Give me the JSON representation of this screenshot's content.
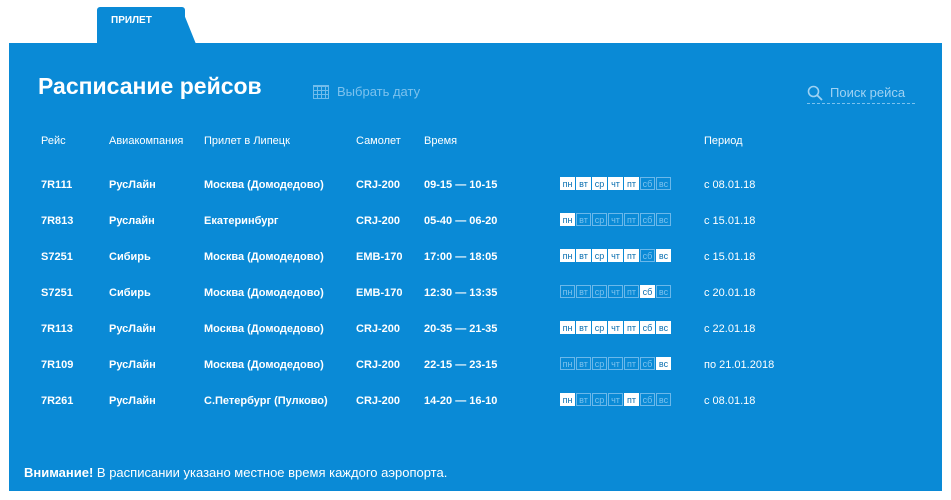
{
  "tab": {
    "label": "ПРИЛЕТ"
  },
  "header": {
    "title": "Расписание рейсов",
    "date_picker_label": "Выбрать дату",
    "search_label": "Поиск рейса"
  },
  "columns": {
    "flight": "Рейс",
    "airline": "Авиакомпания",
    "arrival": "Прилет в Липецк",
    "aircraft": "Самолет",
    "time": "Время",
    "period": "Период"
  },
  "day_labels": [
    "пн",
    "вт",
    "ср",
    "чт",
    "пт",
    "сб",
    "вс"
  ],
  "flights": [
    {
      "flight": "7R111",
      "airline": "РусЛайн",
      "from": "Москва (Домодедово)",
      "aircraft": "CRJ-200",
      "time": "09-15 — 10-15",
      "days": [
        1,
        1,
        1,
        1,
        1,
        0,
        0
      ],
      "period": "с 08.01.18"
    },
    {
      "flight": "7R813",
      "airline": "Руслайн",
      "from": "Екатеринбург",
      "aircraft": "CRJ-200",
      "time": "05-40 — 06-20",
      "days": [
        1,
        0,
        0,
        0,
        0,
        0,
        0
      ],
      "period": "с 15.01.18"
    },
    {
      "flight": "S7251",
      "airline": "Сибирь",
      "from": "Москва (Домодедово)",
      "aircraft": "EMB-170",
      "time": "17:00 — 18:05",
      "days": [
        1,
        1,
        1,
        1,
        1,
        0,
        1
      ],
      "period": "с 15.01.18"
    },
    {
      "flight": "S7251",
      "airline": "Сибирь",
      "from": "Москва (Домодедово)",
      "aircraft": "EMB-170",
      "time": "12:30 — 13:35",
      "days": [
        0,
        0,
        0,
        0,
        0,
        1,
        0
      ],
      "period": "с 20.01.18"
    },
    {
      "flight": "7R113",
      "airline": "РусЛайн",
      "from": "Москва (Домодедово)",
      "aircraft": "CRJ-200",
      "time": "20-35 — 21-35",
      "days": [
        1,
        1,
        1,
        1,
        1,
        1,
        1
      ],
      "period": "с 22.01.18"
    },
    {
      "flight": "7R109",
      "airline": "РусЛайн",
      "from": "Москва (Домодедово)",
      "aircraft": "CRJ-200",
      "time": "22-15 — 23-15",
      "days": [
        0,
        0,
        0,
        0,
        0,
        0,
        1
      ],
      "period": "по 21.01.2018"
    },
    {
      "flight": "7R261",
      "airline": "РусЛайн",
      "from": "С.Петербург (Пулково)",
      "aircraft": "CRJ-200",
      "time": "14-20 — 16-10",
      "days": [
        1,
        0,
        0,
        0,
        1,
        0,
        0
      ],
      "period": "с 08.01.18"
    }
  ],
  "notice": {
    "bold": "Внимание!",
    "text": " В расписании указано местное время каждого аэропорта."
  },
  "colors": {
    "panel": "#0a8ad6",
    "text": "#ffffff",
    "muted": "#7cc2ee"
  },
  "icons": {
    "calendar": "calendar-icon",
    "search": "search-icon"
  }
}
